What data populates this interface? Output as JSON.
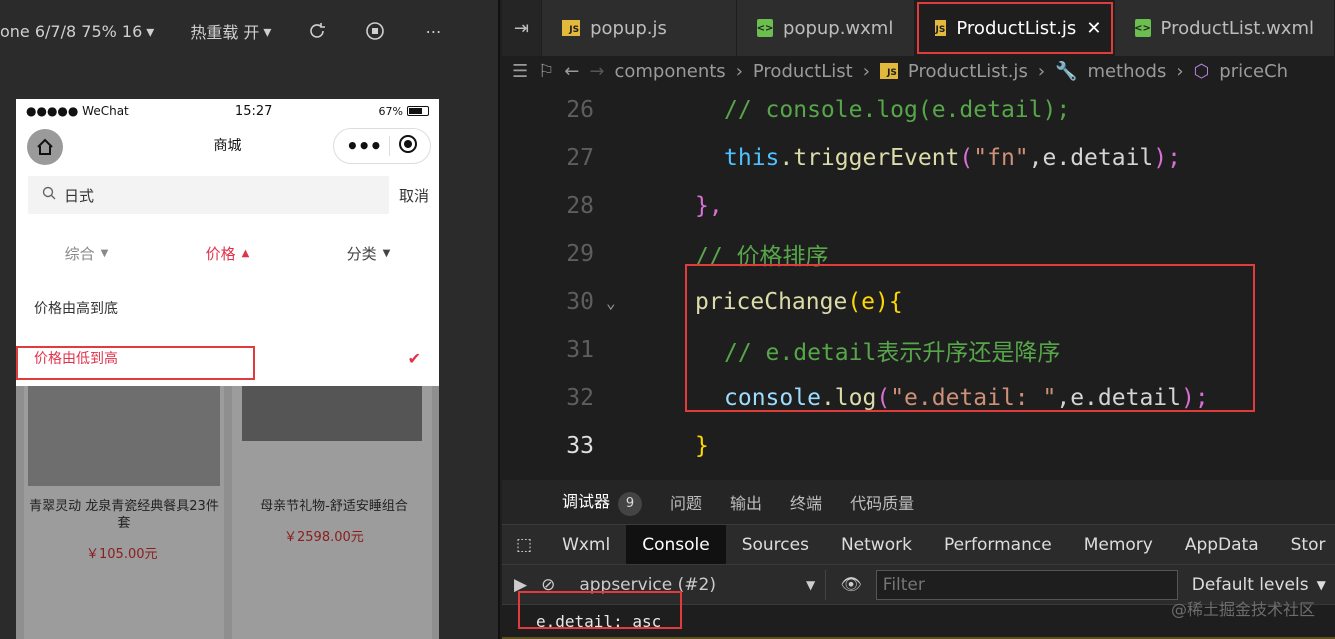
{
  "simulator_toolbar": {
    "device_label": "one 6/7/8 75% 16",
    "hot_reload_label": "热重载 开"
  },
  "phone": {
    "status": {
      "signal": "●●●●● WeChat",
      "time": "15:27",
      "battery": "67%"
    },
    "nav_title": "商城",
    "search": {
      "value": "日式",
      "cancel": "取消"
    },
    "sort_tabs": [
      "综合",
      "价格",
      "分类"
    ],
    "dropdown_options": [
      "价格由高到底",
      "价格由低到高"
    ],
    "products": [
      {
        "title": "青翠灵动 龙泉青瓷经典餐具23件套",
        "price": "￥105.00元"
      },
      {
        "title": "母亲节礼物-舒适安睡组合",
        "price": "￥2598.00元"
      }
    ]
  },
  "editor": {
    "tabs": [
      "popup.js",
      "popup.wxml",
      "ProductList.js",
      "ProductList.wxml"
    ],
    "breadcrumb": [
      "components",
      "ProductList",
      "ProductList.js",
      "methods",
      "priceCh"
    ],
    "line_numbers": [
      "26",
      "27",
      "28",
      "29",
      "30",
      "31",
      "32",
      "33"
    ],
    "code": {
      "l26": "// console.log(e.detail);",
      "l27_kw": "this",
      "l27_fn": ".triggerEvent",
      "l27_open": "(",
      "l27_str": "\"fn\"",
      "l27_rest": ",e.detail",
      "l27_close": ");",
      "l28": "},",
      "l29": "// 价格排序",
      "l30_fn": "priceChange",
      "l30_args": "(e)",
      "l30_brace": "{",
      "l31": "// e.detail表示升序还是降序",
      "l32_obj": "console",
      "l32_fn": ".log",
      "l32_open": "(",
      "l32_str": "\"e.detail: \"",
      "l32_rest": ",e.detail",
      "l32_close": ");",
      "l33": "}"
    }
  },
  "debugger": {
    "tabs": [
      "调试器",
      "问题",
      "输出",
      "终端",
      "代码质量"
    ],
    "badge": "9",
    "devtools_tabs": [
      "Wxml",
      "Console",
      "Sources",
      "Network",
      "Performance",
      "Memory",
      "AppData",
      "Stor"
    ],
    "context": "appservice (#2)",
    "filter_placeholder": "Filter",
    "levels": "Default levels",
    "console_output": "e.detail:  asc"
  },
  "watermark": "@稀土掘金技术社区"
}
